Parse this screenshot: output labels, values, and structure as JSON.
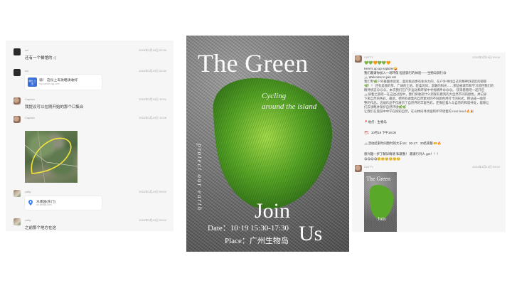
{
  "left_chat": {
    "messages": [
      {
        "sender": "ssl",
        "time": "2024年3月19日 22:34",
        "text": "还有一个餐馆的 :("
      },
      {
        "sender": "ssl",
        "time": "2024年3月19日 22:34",
        "card_thumb": "骑行 上岛",
        "card_title": "骑！ 这份上岛攻略请收好",
        "card_sub": "mp.weixin.qq.com"
      },
      {
        "sender": "Captain",
        "time": "2024年3月19日 10:41",
        "text": "我提议可以在刚开始的那个口集合"
      },
      {
        "sender": "Captain",
        "time": "2024年3月19日 10:48"
      },
      {
        "sender": "catty",
        "time": "2024年3月19日 09:04",
        "card_title": "水墨园(东门)",
        "card_sub": "uri.amap.com"
      },
      {
        "sender": "catty",
        "time": "2024年3月19日 09:04",
        "text": "之前那个地方在这"
      }
    ]
  },
  "poster": {
    "title": "The Green",
    "subtitle_line1": "Cycling",
    "subtitle_line2": "around the island",
    "vertical_text": "protect our earth",
    "join": "Join",
    "us": "Us",
    "date": "Date：10·19 15:30-17:30",
    "place": "Place：广州生物岛"
  },
  "right_chat": {
    "sender": "CATTY",
    "time": "2024年3月19日 09:04",
    "hearts": "💚💚🧡💚💚🧡",
    "lines": [
      "Here's up up explorer🤪",
      "我们邀请你加入一场环保 短途骑行的体验——生物岛骑行😄",
      "🚲 Welcome to join us!",
      "我们专🌿户外群趣体验家，喜欢挑战更有生命力的，在户外寻找自己的精神舒适区的郁郁",
      "🌿！！ 还有美丽的草、广阔的土地、轻柔的风，温暖的阳光……那些被城市和学习遮挡我们的",
      "精神状态😊😊😊。本次我们在户外运动和环保中寻找精神😄😄😄。 快来看看吧一起开启",
      "🚲骑着之旅吧一在这边过程中，我们将收获什么到保有看到的大自然不同的颜色，并记录",
      "下来自然的色彩，最后，把所有收集的自然素材的不同颜色用打卡的形式，把钻成一幅完",
      "整的作品。这幅作品不仅展示了自然界的丰富色彩，还像征着人与自然的和谐共处，能够让",
      "们去领略并保护自然环境🌿🌿",
      "让我们在旅游中中学在探知自然，在山林间寻找宿和坏环境着的 next level 🔥🎉"
    ],
    "location": "📍地点：生物岛",
    "time_line": "⏰：10月19 下午16:00",
    "note": "🚲活动结束时间暂时的大于15：30-17：30结束整 🎫🔥",
    "cta": "感兴趣一步了解详情请 私聊我！ 邀请行列人 get！！！",
    "emoji_row": "😋😋😋😋🥺🥺🥺🥺🥺🥺",
    "second_sender": "CATTY",
    "second_time": "2024年3月19日 09:04",
    "mini_title": "The Green",
    "mini_join": "Join"
  }
}
